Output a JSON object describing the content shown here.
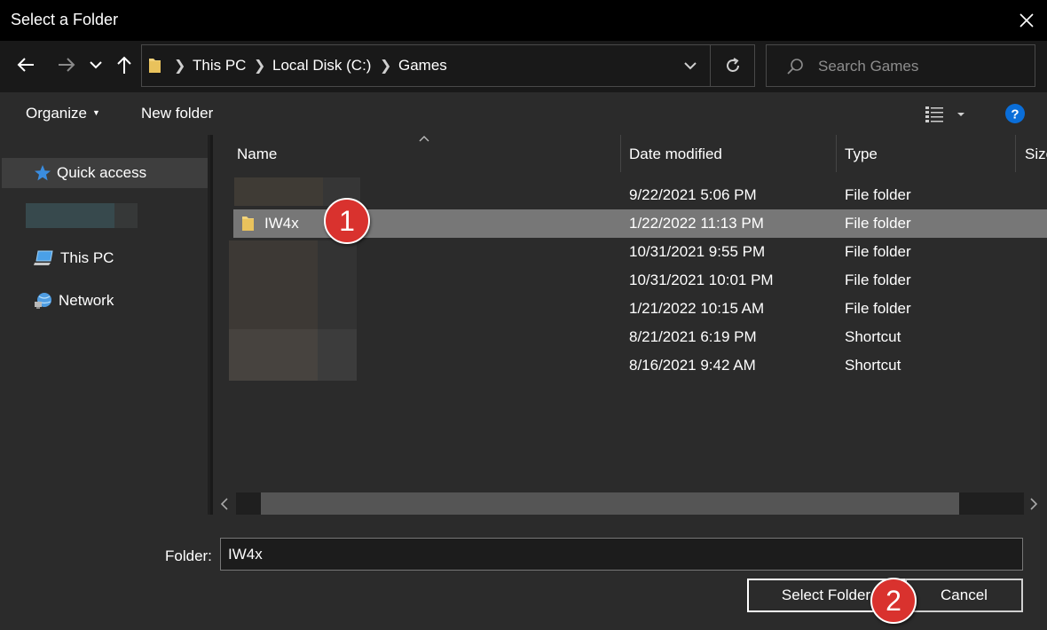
{
  "window": {
    "title": "Select a Folder"
  },
  "address": {
    "crumbs": [
      "This PC",
      "Local Disk (C:)",
      "Games"
    ]
  },
  "search": {
    "placeholder": "Search Games"
  },
  "toolbar": {
    "organize_label": "Organize",
    "new_folder_label": "New folder"
  },
  "sidebar": {
    "items": [
      {
        "label": "Quick access",
        "icon": "star-icon"
      },
      {
        "label": "This PC",
        "icon": "computer-icon"
      },
      {
        "label": "Network",
        "icon": "network-icon"
      }
    ]
  },
  "columns": {
    "name": "Name",
    "date_modified": "Date modified",
    "type": "Type",
    "size": "Size"
  },
  "files": [
    {
      "name": "",
      "date": "9/22/2021 5:06 PM",
      "type": "File folder"
    },
    {
      "name": "IW4x",
      "date": "1/22/2022 11:13 PM",
      "type": "File folder"
    },
    {
      "name": "",
      "date": "10/31/2021 9:55 PM",
      "type": "File folder"
    },
    {
      "name": "",
      "date": "10/31/2021 10:01 PM",
      "type": "File folder"
    },
    {
      "name": "",
      "date": "1/21/2022 10:15 AM",
      "type": "File folder"
    },
    {
      "name": "",
      "date": "8/21/2021 6:19 PM",
      "type": "Shortcut"
    },
    {
      "name": "",
      "date": "8/16/2021 9:42 AM",
      "type": "Shortcut"
    }
  ],
  "footer": {
    "folder_label": "Folder:",
    "folder_value": "IW4x",
    "select_label": "Select Folder",
    "cancel_label": "Cancel"
  },
  "annotations": {
    "step1": "1",
    "step2": "2"
  },
  "colors": {
    "accent": "#d9322e",
    "selection": "#777777",
    "help": "#0a6ed9",
    "folder": "#f3d37a"
  }
}
